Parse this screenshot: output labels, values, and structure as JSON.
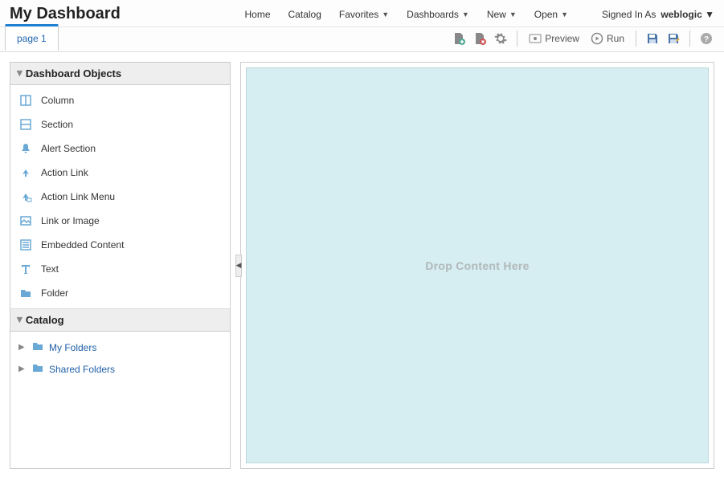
{
  "header": {
    "title": "My Dashboard",
    "nav": {
      "home": "Home",
      "catalog": "Catalog",
      "favorites": "Favorites",
      "dashboards": "Dashboards",
      "new": "New",
      "open": "Open"
    },
    "signed_in_label": "Signed In As",
    "username": "weblogic"
  },
  "tabs": {
    "page1": "page 1"
  },
  "toolbar": {
    "preview": "Preview",
    "run": "Run"
  },
  "left": {
    "objects_title": "Dashboard Objects",
    "objects": {
      "column": "Column",
      "section": "Section",
      "alert_section": "Alert Section",
      "action_link": "Action Link",
      "action_link_menu": "Action Link Menu",
      "link_or_image": "Link or Image",
      "embedded_content": "Embedded Content",
      "text": "Text",
      "folder": "Folder"
    },
    "catalog_title": "Catalog",
    "catalog": {
      "my_folders": "My Folders",
      "shared_folders": "Shared Folders"
    }
  },
  "canvas": {
    "drop_hint": "Drop Content Here"
  }
}
